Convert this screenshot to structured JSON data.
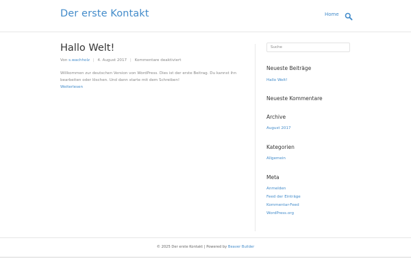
{
  "site": {
    "title": "Der erste Kontakt",
    "nav": {
      "home": "Home"
    },
    "accent": "#428bca"
  },
  "post": {
    "title": "Hallo Welt!",
    "meta": {
      "by": "Von",
      "author": "s.wachholz",
      "date": "4. August 2017",
      "comments": "Kommentare deaktiviert"
    },
    "excerpt": "Willkommen zur deutschen Version von WordPress. Dies ist der erste Beitrag. Du kannst ihn bearbeiten oder löschen. Und dann starte mit dem Schreiben!",
    "read_more": "Weiterlesen"
  },
  "sidebar": {
    "search_placeholder": "Suche",
    "widgets": {
      "recent_posts": {
        "title": "Neueste Beiträge",
        "items": [
          "Hallo Welt!"
        ]
      },
      "recent_comments": {
        "title": "Neueste Kommentare"
      },
      "archive": {
        "title": "Archive",
        "items": [
          "August 2017"
        ]
      },
      "categories": {
        "title": "Kategorien",
        "items": [
          "Allgemein"
        ]
      },
      "meta": {
        "title": "Meta",
        "items": [
          "Anmelden",
          "Feed der Einträge",
          "Kommentar-Feed",
          "WordPress.org"
        ]
      }
    }
  },
  "footer": {
    "text": "© 2025 Der erste Kontakt | Powered by",
    "builder_link": "Beaver Builder"
  }
}
